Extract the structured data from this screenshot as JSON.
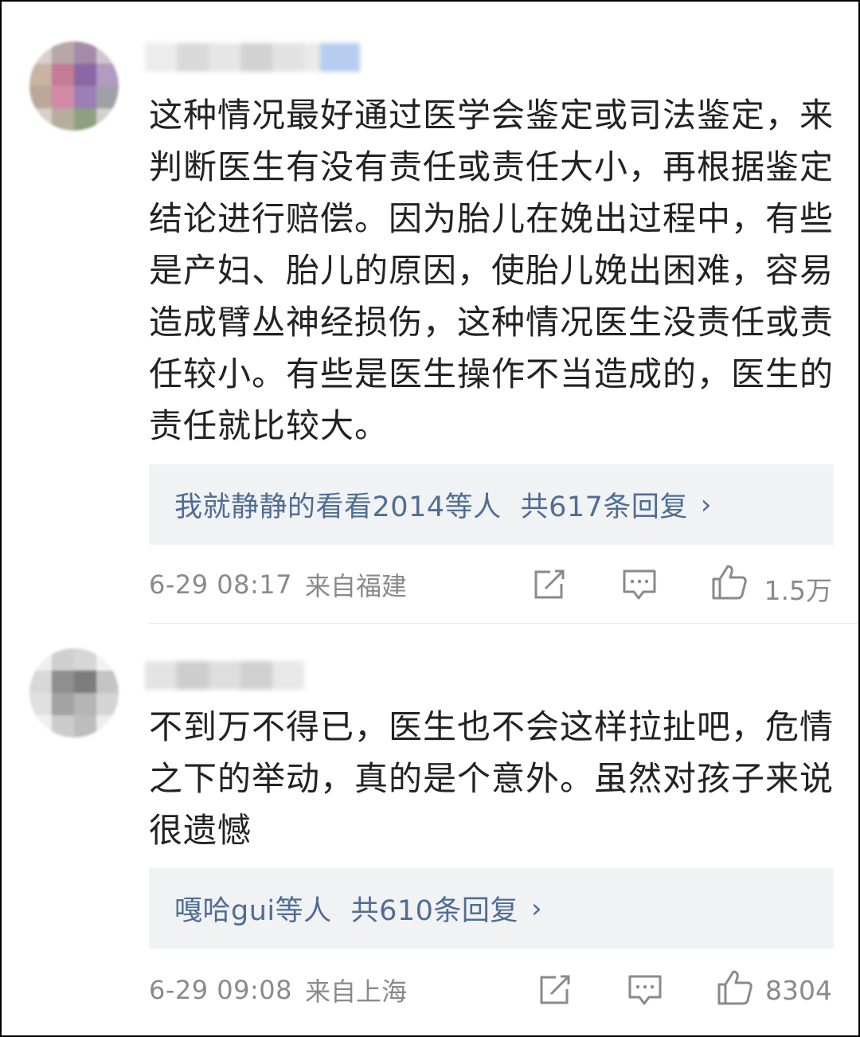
{
  "comments": [
    {
      "text": "这种情况最好通过医学会鉴定或司法鉴定，来判断医生有没有责任或责任大小，再根据鉴定结论进行赔偿。因为胎儿在娩出过程中，有些是产妇、胎儿的原因，使胎儿娩出困难，容易造成臂丛神经损伤，这种情况医生没责任或责任较小。有些是医生操作不当造成的，医生的责任就比较大。",
      "replies_users": "我就静静的看看2014等人",
      "replies_count": "共617条回复",
      "replies_chevron": "›",
      "time": "6-29 08:17",
      "location": "来自福建",
      "likes": "1.5万"
    },
    {
      "text": "不到万不得已，医生也不会这样拉扯吧，危情之下的举动，真的是个意外。虽然对孩子来说很遗憾",
      "replies_users": "嘎哈gui等人",
      "replies_count": "共610条回复",
      "replies_chevron": "›",
      "time": "6-29 09:08",
      "location": "来自上海",
      "likes": "8304"
    }
  ],
  "icons": {
    "repost": "repost-icon",
    "comment": "comment-icon",
    "like": "thumbs-up-icon"
  },
  "colors": {
    "link": "#4f6d94",
    "meta": "#8a8a8a",
    "reply_bg": "#f1f2f4",
    "text": "#222222"
  }
}
